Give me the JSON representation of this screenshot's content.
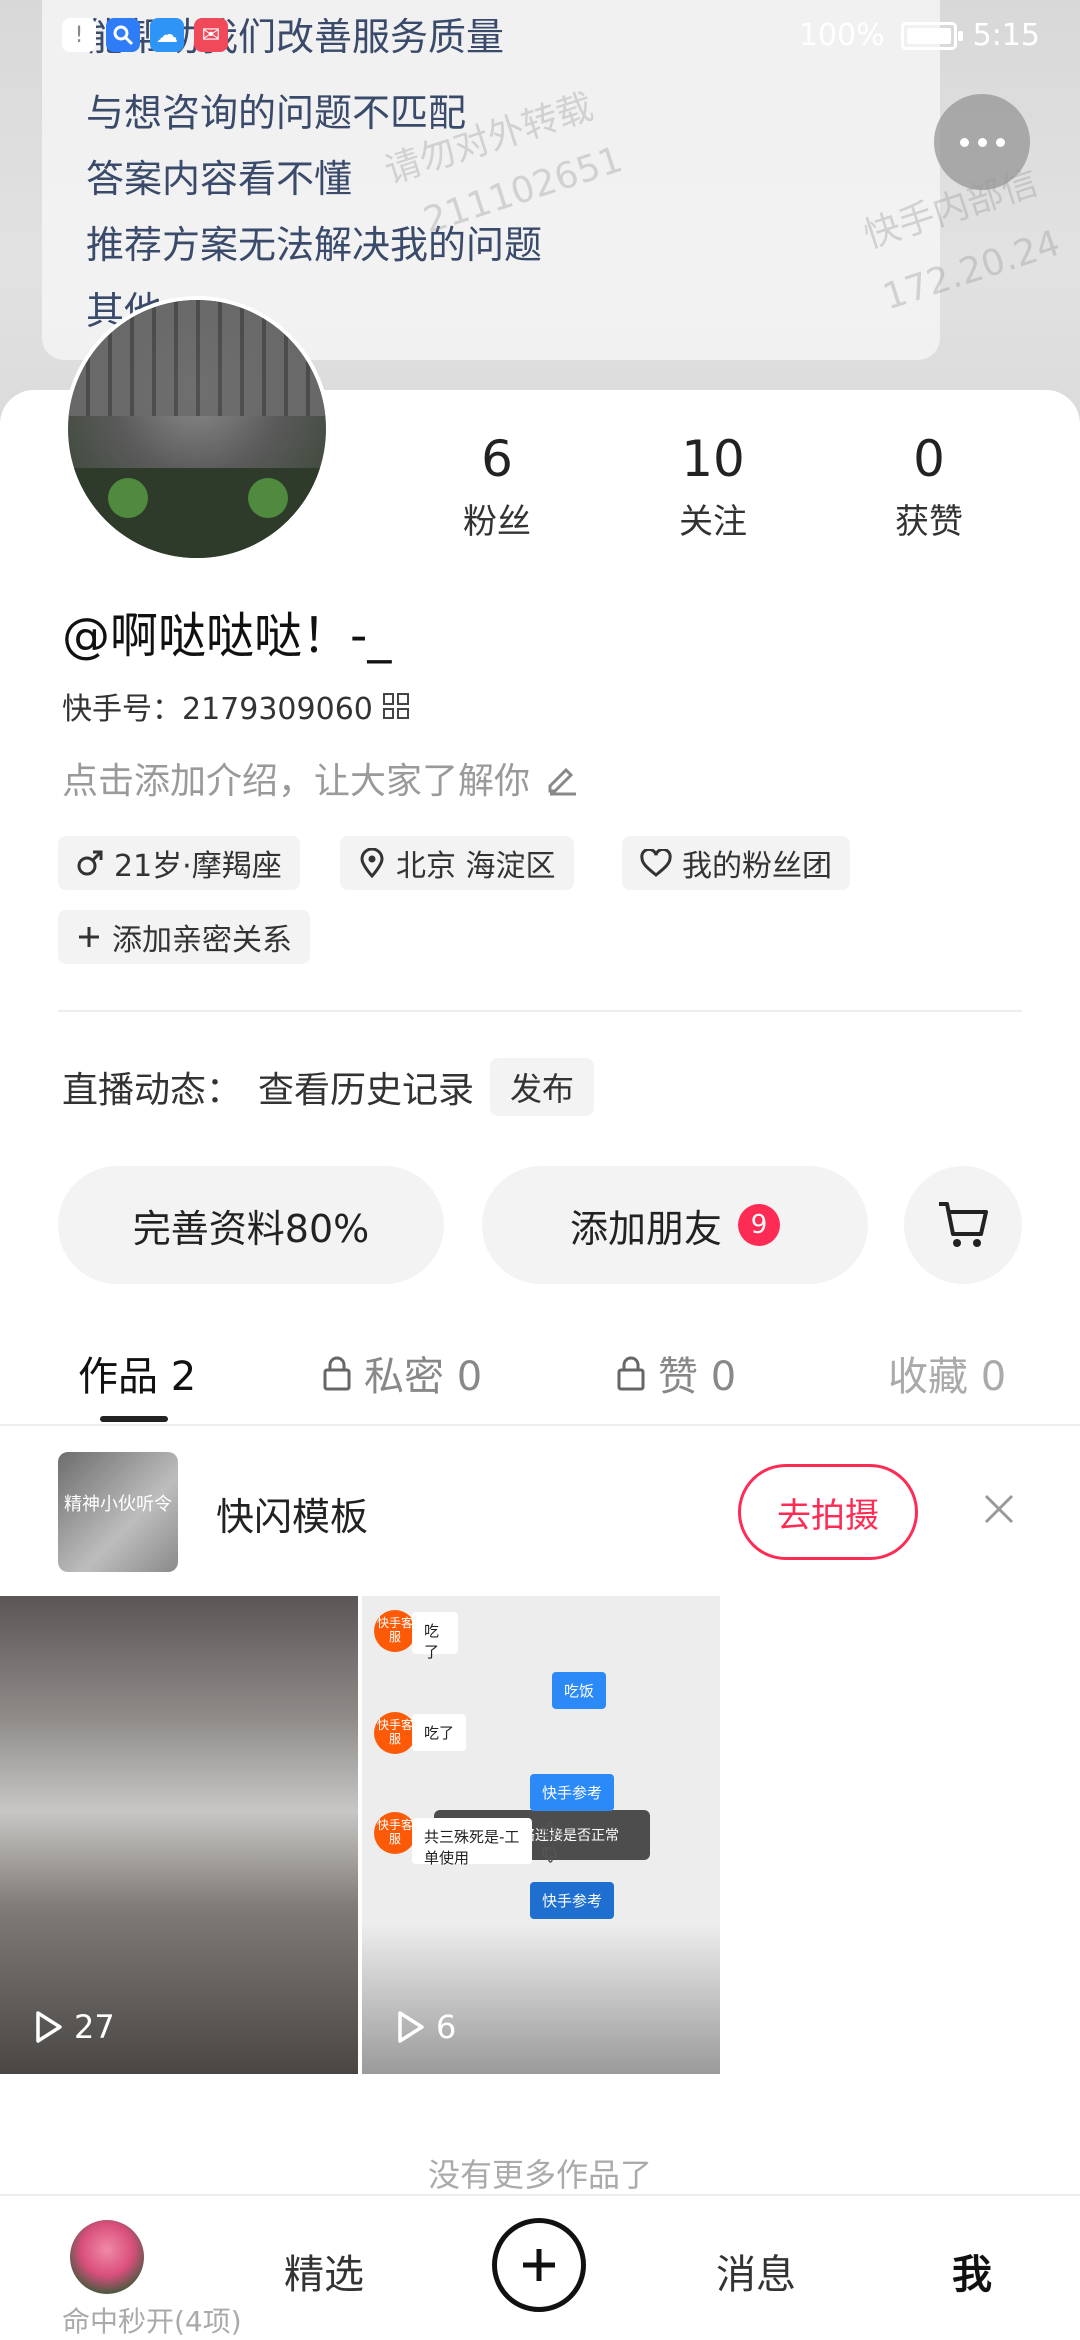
{
  "status_bar": {
    "battery": "100%",
    "battery_level": 1.0,
    "time": "5:15"
  },
  "cover": {
    "lines": [
      "能帮助我们改善服务质量",
      "与想咨询的问题不匹配",
      "答案内容看不懂",
      "推荐方案无法解决我的问题",
      "其他"
    ],
    "watermarks": [
      "请勿对外转载",
      "211102651",
      "快手内部信",
      "172.20.24"
    ]
  },
  "profile": {
    "stats": [
      {
        "value": "6",
        "label": "粉丝"
      },
      {
        "value": "10",
        "label": "关注"
      },
      {
        "value": "0",
        "label": "获赞"
      }
    ],
    "nickname": "@啊哒哒哒！-_",
    "kuaishou_id": "快手号：2179309060",
    "intro_placeholder": "点击添加介绍，让大家了解你",
    "tags": [
      "21岁·摩羯座",
      "北京 海淀区",
      "我的粉丝团",
      "添加亲密关系"
    ]
  },
  "live": {
    "label": "直播动态：",
    "history": "查看历史记录",
    "publish": "发布"
  },
  "actions": {
    "complete_profile": "完善资料80%",
    "add_friends": "添加朋友",
    "add_friends_badge": "9"
  },
  "tabs": [
    {
      "label": "作品 2"
    },
    {
      "label": "私密 0"
    },
    {
      "label": "赞 0"
    },
    {
      "label": "收藏 0"
    }
  ],
  "banner": {
    "thumb_text": "精神小伙听令",
    "title": "快闪模板",
    "button": "去拍摄"
  },
  "works": [
    {
      "plays": "27"
    },
    {
      "plays": "6",
      "chat": {
        "avatar_label": "快手客服",
        "msg1": "吃了",
        "reply1": "吃饭",
        "msg2": "吃了",
        "toast": "请检查网络连接是否正常",
        "reply2": "快手参考",
        "msg3": "共三殊死是-工单使用",
        "reply3": "快手参考"
      }
    }
  ],
  "no_more": "没有更多作品了",
  "bottom_nav": {
    "avatar_label": "命中秒开(4项)",
    "featured": "精选",
    "messages": "消息",
    "me": "我"
  },
  "colors": {
    "accent": "#fe2c55",
    "chat_blue": "#2b8af7",
    "cs_orange": "#fc5a07"
  }
}
